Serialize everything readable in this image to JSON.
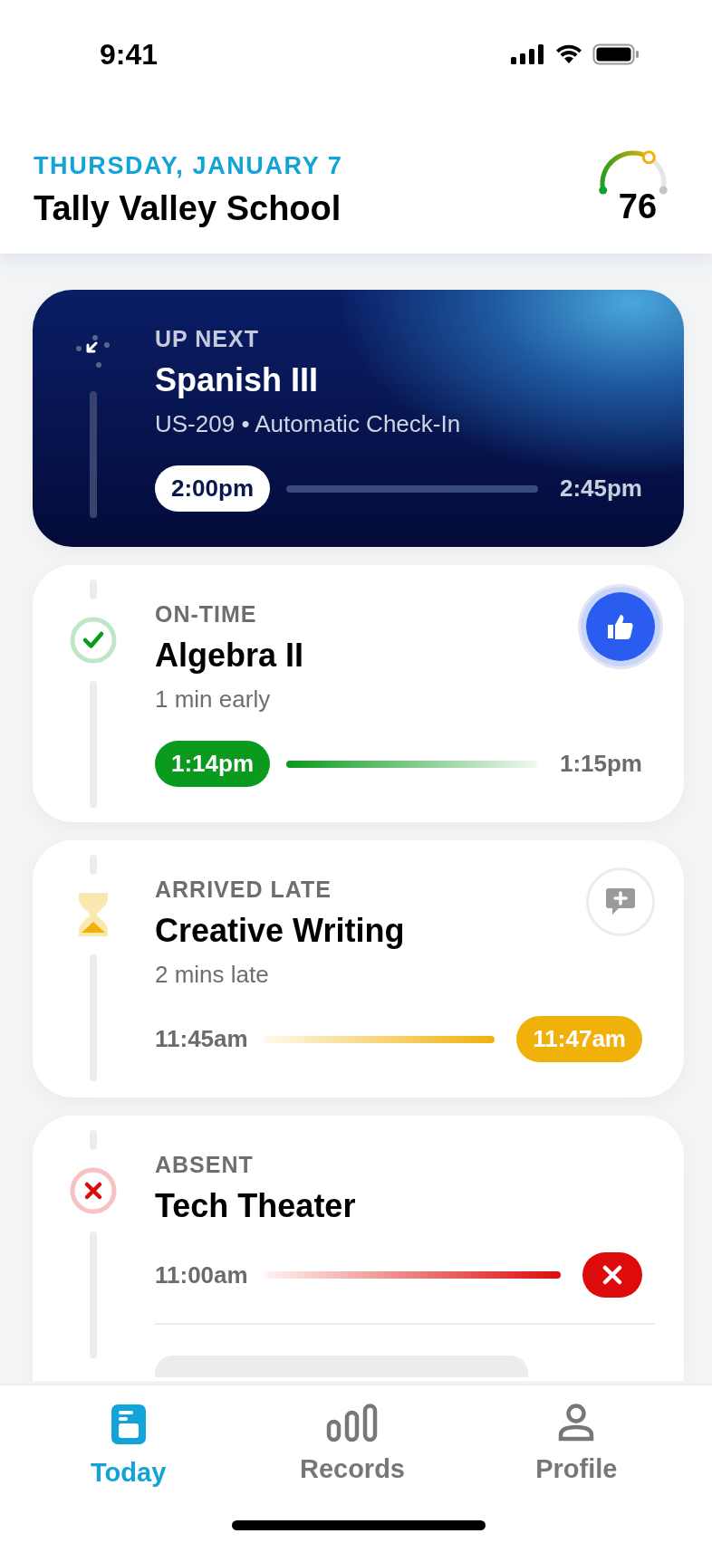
{
  "status_bar": {
    "time": "9:41"
  },
  "header": {
    "date": "THURSDAY, JANUARY 7",
    "school": "Tally Valley School",
    "score": {
      "value": "76",
      "level": 0.76
    }
  },
  "classes": [
    {
      "kind": "up_next",
      "status": "UP NEXT",
      "title": "Spanish III",
      "detail": "US-209 • Automatic Check-In",
      "start": {
        "text": "2:00pm",
        "highlighted": true
      },
      "end": {
        "text": "2:45pm",
        "highlighted": false
      }
    },
    {
      "kind": "on_time",
      "status": "ON-TIME",
      "title": "Algebra II",
      "detail": "1 min early",
      "start": {
        "text": "1:14pm",
        "highlighted": true
      },
      "end": {
        "text": "1:15pm",
        "highlighted": false
      }
    },
    {
      "kind": "late",
      "status": "ARRIVED LATE",
      "title": "Creative Writing",
      "detail": "2 mins late",
      "start": {
        "text": "11:45am",
        "highlighted": false
      },
      "end": {
        "text": "11:47am",
        "highlighted": true
      }
    },
    {
      "kind": "absent",
      "status": "ABSENT",
      "title": "Tech Theater",
      "start": {
        "text": "11:00am",
        "highlighted": false
      },
      "end": {
        "highlighted": true
      }
    }
  ],
  "tabs": [
    {
      "label": "Today",
      "selected": true
    },
    {
      "label": "Records",
      "selected": false
    },
    {
      "label": "Profile",
      "selected": false
    }
  ]
}
